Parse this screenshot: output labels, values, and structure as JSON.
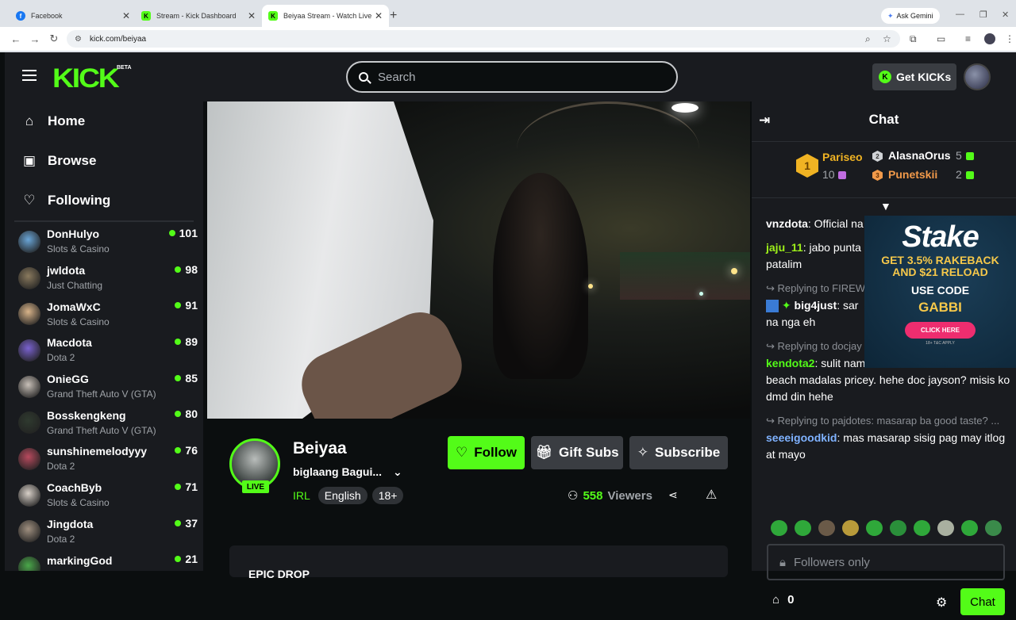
{
  "browser": {
    "tabs": [
      {
        "title": "Facebook",
        "favicon_color": "#1877f2",
        "favicon_letter": "f"
      },
      {
        "title": "Stream - Kick Dashboard",
        "favicon_color": "#53fc18",
        "favicon_letter": "K"
      },
      {
        "title": "Beiyaa Stream - Watch Live on Kick",
        "favicon_color": "#53fc18",
        "favicon_letter": "K"
      }
    ],
    "new_tab": "+",
    "gemini": "Ask Gemini",
    "url": "kick.com/beiyaa"
  },
  "header": {
    "logo": "KICK",
    "beta": "BETA",
    "search_placeholder": "Search",
    "get_kicks": "Get KICKs"
  },
  "sidebar": {
    "nav": [
      {
        "label": "Home",
        "icon": "home-icon",
        "glyph": "⌂"
      },
      {
        "label": "Browse",
        "icon": "browse-icon",
        "glyph": "▣"
      },
      {
        "label": "Following",
        "icon": "heart-icon",
        "glyph": "♡"
      }
    ],
    "channels": [
      {
        "name": "DonHulyo",
        "category": "Slots & Casino",
        "viewers": "101",
        "color": "#6aa6d8"
      },
      {
        "name": "jwldota",
        "category": "Just Chatting",
        "viewers": "98",
        "color": "#8a7a5e"
      },
      {
        "name": "JomaWxC",
        "category": "Slots & Casino",
        "viewers": "91",
        "color": "#d9b48a"
      },
      {
        "name": "Macdota",
        "category": "Dota 2",
        "viewers": "89",
        "color": "#7a62d0"
      },
      {
        "name": "OnieGG",
        "category": "Grand Theft Auto V (GTA)",
        "viewers": "85",
        "color": "#c8c0b8"
      },
      {
        "name": "Bosskengkeng",
        "category": "Grand Theft Auto V (GTA)",
        "viewers": "80",
        "color": "#2f3a2f"
      },
      {
        "name": "sunshinemelodyyy",
        "category": "Dota 2",
        "viewers": "76",
        "color": "#b84a5e"
      },
      {
        "name": "CoachByb",
        "category": "Slots & Casino",
        "viewers": "71",
        "color": "#d8d0c8"
      },
      {
        "name": "Jingdota",
        "category": "Dota 2",
        "viewers": "37",
        "color": "#a09080"
      },
      {
        "name": "markingGod",
        "category": "Crypto & Trading",
        "viewers": "21",
        "color": "#4aa84a"
      }
    ]
  },
  "stream": {
    "name": "Beiyaa",
    "title": "biglaang Bagui...",
    "live": "LIVE",
    "category": "IRL",
    "tags": [
      "English",
      "18+"
    ],
    "follow": "Follow",
    "gift_subs": "Gift Subs",
    "subscribe": "Subscribe",
    "viewers_count": "558",
    "viewers_label": "Viewers",
    "panel_title": "EPIC DROP"
  },
  "chat": {
    "title": "Chat",
    "leaderboard": {
      "first": {
        "name": "Pariseo",
        "value": "10",
        "rank": "1"
      },
      "second": {
        "name": "AlasnaOrus",
        "value": "5",
        "rank": "2"
      },
      "third": {
        "name": "Punetskii",
        "value": "2",
        "rank": "3"
      }
    },
    "messages": [
      {
        "user": "vnzdota",
        "color": "#ffffff",
        "text": "Official na",
        "reply": ""
      },
      {
        "user": "jaju_11",
        "color": "#9ef01a",
        "text": "jabo punta a",
        "text2": "patalim",
        "reply": ""
      },
      {
        "user": "big4just",
        "color": "#ffffff",
        "text": "sar",
        "text2": "na nga eh",
        "reply": "Replying to FIREW"
      },
      {
        "user": "kendota2",
        "color": "#53fc18",
        "text": "sulit nam",
        "text2": "beach madalas pricey. hehe doc jayson? misis ko dmd din hehe",
        "reply": "Replying to docjay"
      },
      {
        "user": "seeeigoodkid",
        "color": "#7fb2ff",
        "text": "mas masarap sisig pag may itlog at mayo",
        "reply": "Replying to pajdotes: masarap ba good taste? ..."
      }
    ],
    "ad": {
      "brand": "Stake",
      "line1": "GET 3.5% RAKEBACK",
      "line2": "AND $21 RELOAD",
      "line3": "USE CODE",
      "code": "GABBI",
      "cta": "CLICK HERE",
      "tc": "18+ T&C APPLY"
    },
    "followers_only": "Followers only",
    "points": "0",
    "send": "Chat"
  }
}
